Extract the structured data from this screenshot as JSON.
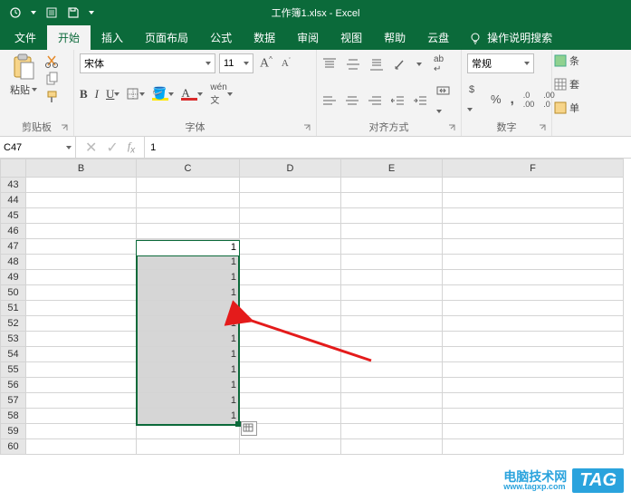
{
  "titlebar": {
    "title": "工作簿1.xlsx - Excel"
  },
  "tabs": {
    "file": "文件",
    "home": "开始",
    "insert": "插入",
    "layout": "页面布局",
    "formulas": "公式",
    "data": "数据",
    "review": "审阅",
    "view": "视图",
    "help": "帮助",
    "cloud": "云盘",
    "tellme": "操作说明搜索"
  },
  "ribbon": {
    "clipboard": {
      "paste": "粘贴",
      "label": "剪贴板"
    },
    "font": {
      "name": "宋体",
      "size": "11",
      "label": "字体"
    },
    "align": {
      "label": "对齐方式"
    },
    "number": {
      "format": "常规",
      "label": "数字"
    },
    "right": {
      "cond": "条",
      "fmt": "套",
      "cell": "单"
    }
  },
  "formulaBar": {
    "nameBox": "C47",
    "value": "1"
  },
  "grid": {
    "cols": [
      "B",
      "C",
      "D",
      "E",
      "F"
    ],
    "rows": [
      43,
      44,
      45,
      46,
      47,
      48,
      49,
      50,
      51,
      52,
      53,
      54,
      55,
      56,
      57,
      58,
      59,
      60
    ],
    "selection": {
      "col": "C",
      "startRow": 47,
      "endRow": 58,
      "value": "1"
    },
    "activeCell": "C47"
  },
  "watermark": {
    "brand": "电脑技术网",
    "tag": "TAG",
    "url": "www.tagxp.com"
  }
}
